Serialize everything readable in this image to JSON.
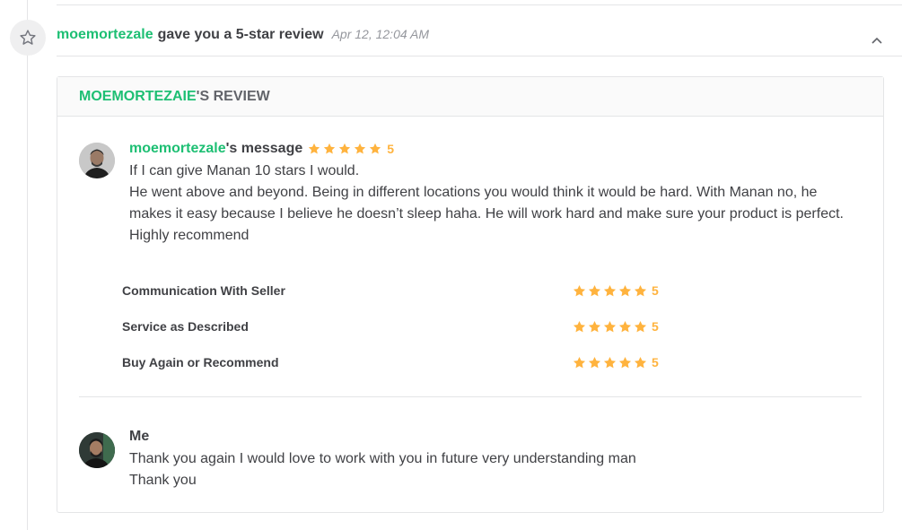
{
  "event": {
    "icon": "star-outline-icon",
    "user": "moemortezale",
    "text": "gave you a 5-star review",
    "time": "Apr 12, 12:04 AM",
    "collapse_icon": "chevron-up-icon"
  },
  "review": {
    "header_name": "MOEMORTEZAIE",
    "header_suffix": "'S REVIEW",
    "message": {
      "username": "moemortezale",
      "title_suffix": "'s message",
      "rating": "5",
      "lines": [
        "If I can give Manan 10 stars I would.",
        "He went above and beyond. Being in different locations you would think it would be hard. With Manan no, he makes it easy because I believe he doesn’t sleep haha. He will work hard and make sure your product is perfect. Highly recommend"
      ]
    },
    "criteria": [
      {
        "label": "Communication With Seller",
        "rating": "5"
      },
      {
        "label": "Service as Described",
        "rating": "5"
      },
      {
        "label": "Buy Again or Recommend",
        "rating": "5"
      }
    ],
    "reply": {
      "author": "Me",
      "lines": [
        "Thank you again I would love to work with you in future very understanding man",
        "Thank you"
      ]
    }
  },
  "colors": {
    "accent_green": "#1dbf73",
    "star_orange": "#ffb33e",
    "text_dark": "#404145",
    "text_muted": "#95979d"
  }
}
